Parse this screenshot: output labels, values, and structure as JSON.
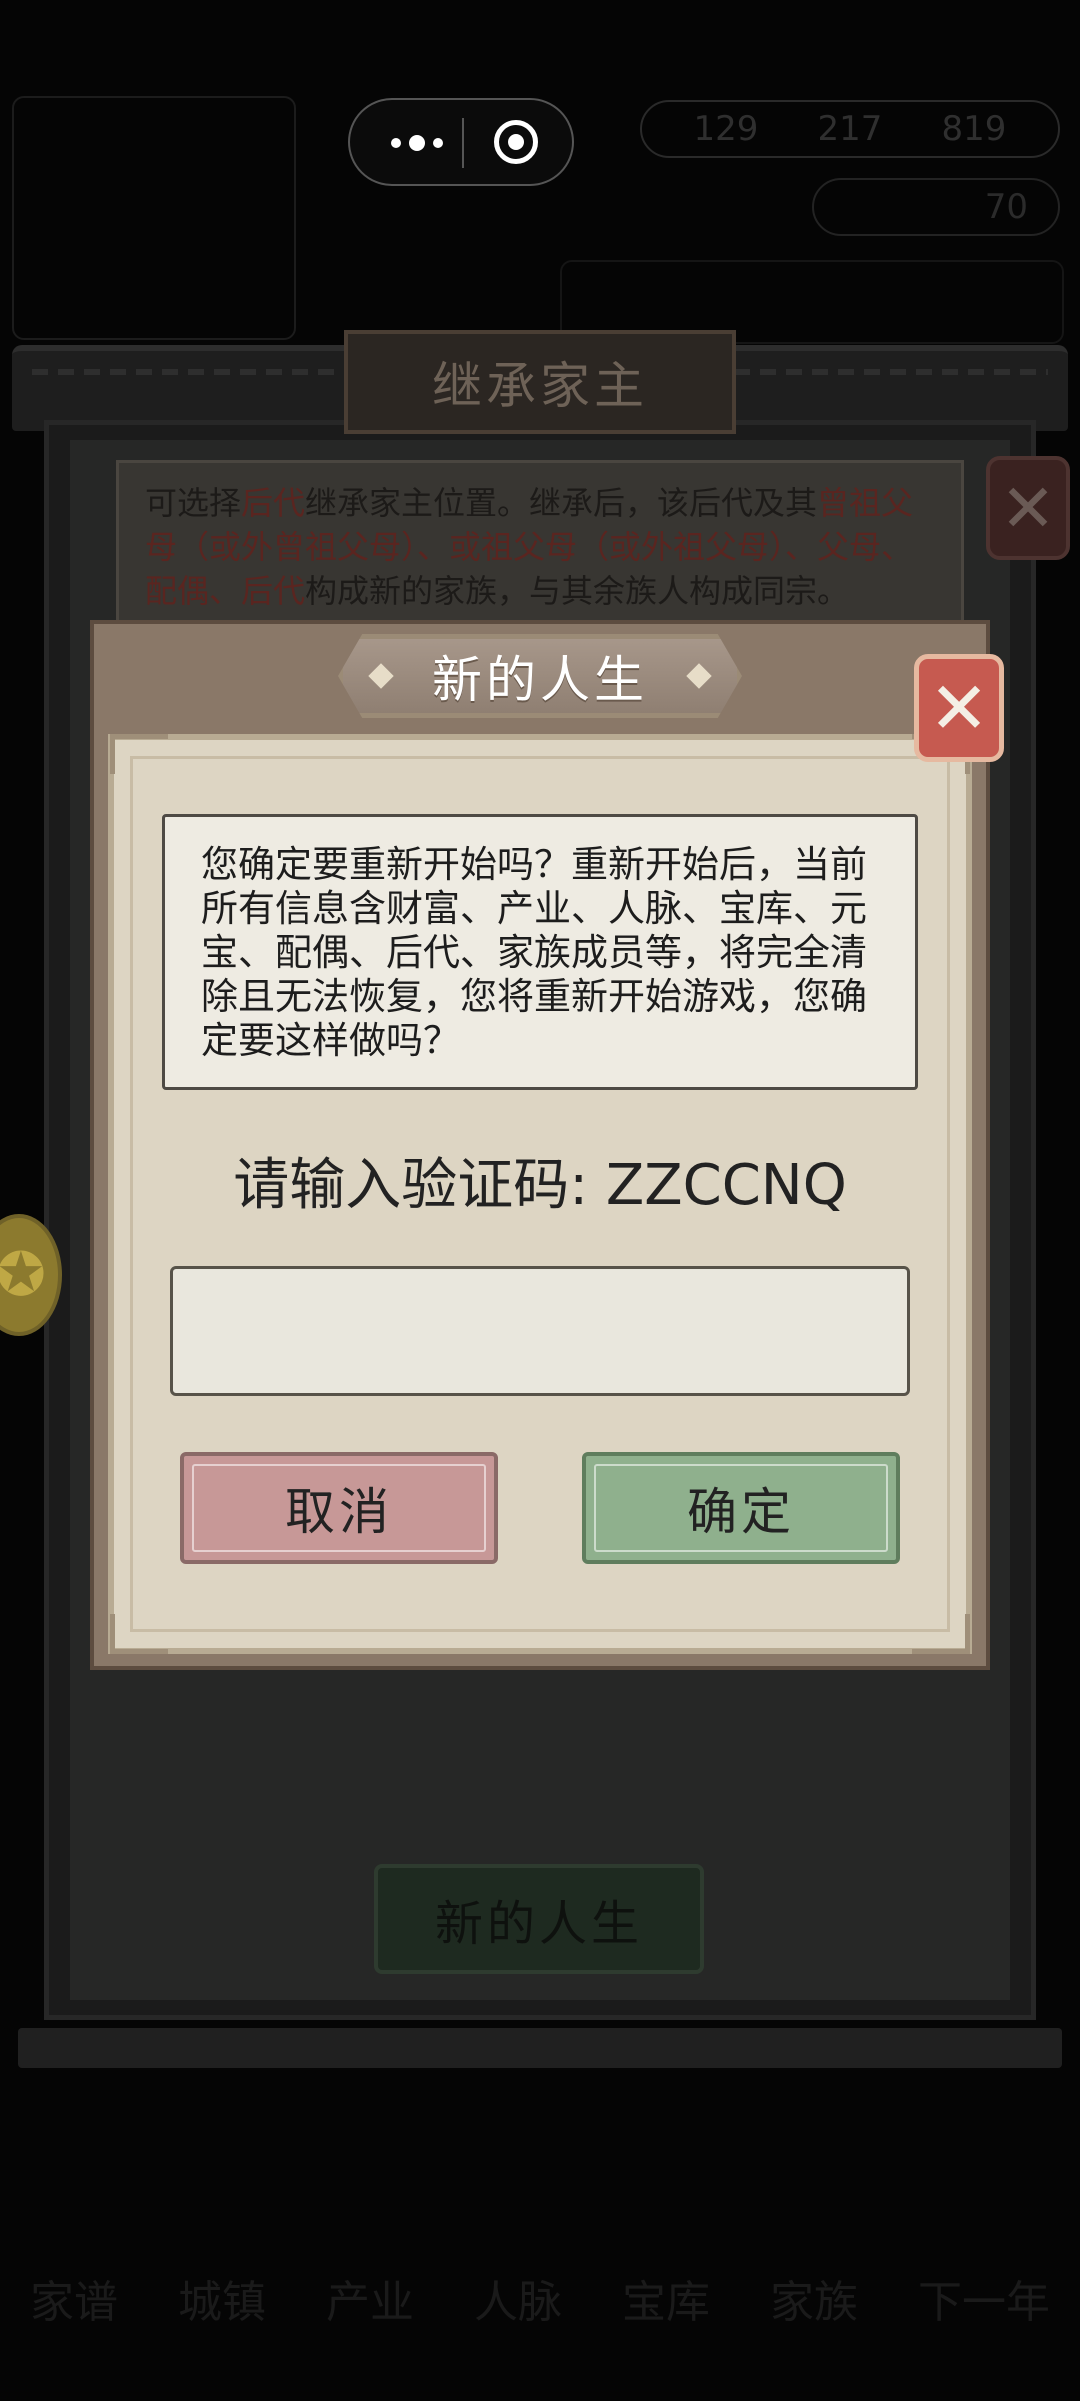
{
  "background": {
    "hud": {
      "values": [
        "129",
        "217",
        "819"
      ],
      "value2": "70"
    },
    "panel_title": "继承家主",
    "description_segments": [
      {
        "text": "可选择",
        "red": false
      },
      {
        "text": "后代",
        "red": true
      },
      {
        "text": "继承家主位置。继承后，该后代及其",
        "red": false
      },
      {
        "text": "曾祖父母（或外曾祖父母）、或祖父母（或外祖父母）、父母、配偶、后代",
        "red": true
      },
      {
        "text": "构成新的家族，与其余族人构成同宗。",
        "red": false
      }
    ],
    "new_life_button": "新的人生",
    "bottom_nav": [
      "家谱",
      "城镇",
      "产业",
      "人脉",
      "宝库",
      "家族",
      "下一年"
    ]
  },
  "dialog": {
    "title": "新的人生",
    "message": "您确定要重新开始吗？重新开始后，当前所有信息含财富、产业、人脉、宝库、元宝、配偶、后代、家族成员等，将完全清除且无法恢复，您将重新开始游戏，您确定要这样做吗？",
    "code_label": "请输入验证码: ZZCCNQ",
    "input_value": "",
    "input_placeholder": "",
    "cancel_label": "取消",
    "confirm_label": "确定"
  },
  "colors": {
    "accent_red": "#c65a50",
    "confirm_green": "#8fb08d",
    "cancel_pink": "#c79897",
    "dialog_bg": "#ddd5c3"
  }
}
